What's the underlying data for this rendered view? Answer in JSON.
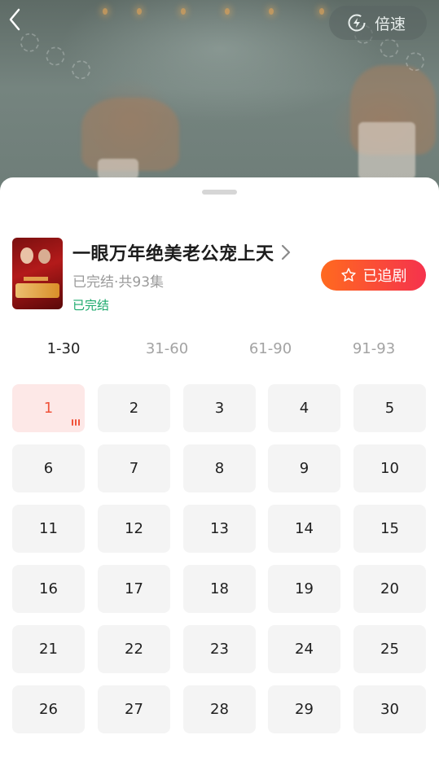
{
  "player": {
    "speed_label": "倍速",
    "back_icon": "chevron-left-icon",
    "speed_icon": "lightning-circle-icon"
  },
  "drama": {
    "title": "一眼万年绝美老公宠上天",
    "meta": "已完结·共93集",
    "status": "已完结",
    "follow_label": "已追剧",
    "follow_icon": "star-icon",
    "status_color": "#1aa96b",
    "accent_gradient": [
      "#ff6a1f",
      "#f5324d"
    ]
  },
  "tabs": [
    {
      "label": "1-30",
      "active": true
    },
    {
      "label": "31-60",
      "active": false
    },
    {
      "label": "61-90",
      "active": false
    },
    {
      "label": "91-93",
      "active": false
    }
  ],
  "episodes": [
    "1",
    "2",
    "3",
    "4",
    "5",
    "6",
    "7",
    "8",
    "9",
    "10",
    "11",
    "12",
    "13",
    "14",
    "15",
    "16",
    "17",
    "18",
    "19",
    "20",
    "21",
    "22",
    "23",
    "24",
    "25",
    "26",
    "27",
    "28",
    "29",
    "30"
  ],
  "current_episode": "1"
}
